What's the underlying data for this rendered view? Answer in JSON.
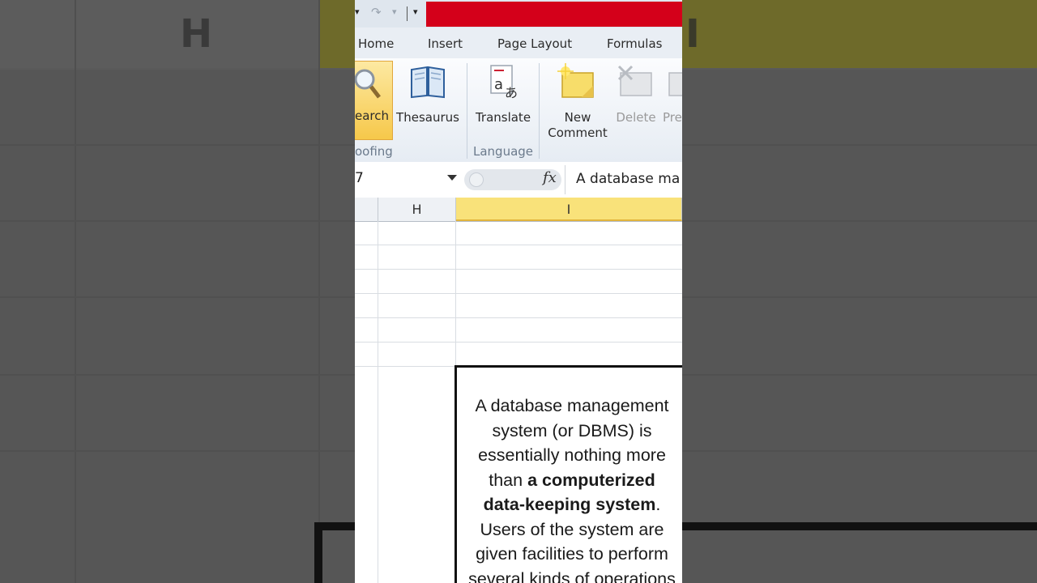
{
  "background": {
    "col_h_label": "H",
    "col_i_label": "I"
  },
  "quick_access": {
    "redo_symbol": "↷"
  },
  "tabs": [
    {
      "label": "Home"
    },
    {
      "label": "Insert"
    },
    {
      "label": "Page Layout"
    },
    {
      "label": "Formulas"
    }
  ],
  "ribbon": {
    "research_label": "earch",
    "thesaurus_label": "Thesaurus",
    "translate_label": "Translate",
    "new_comment_label_1": "New",
    "new_comment_label_2": "Comment",
    "delete_label": "Delete",
    "previous_label": "Pre",
    "group_proofing": "oofing",
    "group_language": "Language"
  },
  "formula_bar": {
    "name_box": "7",
    "fx": "fx",
    "formula": "A database ma"
  },
  "columns": [
    {
      "label": ""
    },
    {
      "label": "H"
    },
    {
      "label": "I"
    }
  ],
  "textbox": {
    "line1": "A database management",
    "line2": "system (or DBMS) is",
    "line3": "essentially nothing more",
    "line4a": "than ",
    "line4b": "a computerized",
    "line5a": "data-keeping system",
    "line5b": ".",
    "line6": "Users of the system are",
    "line7": "given facilities to perform",
    "line8": "several kinds of operations"
  },
  "colors": {
    "title_bar_red": "#d4001a",
    "selected_column": "#f9e27a",
    "ribbon_selected": "#f6c84a"
  }
}
